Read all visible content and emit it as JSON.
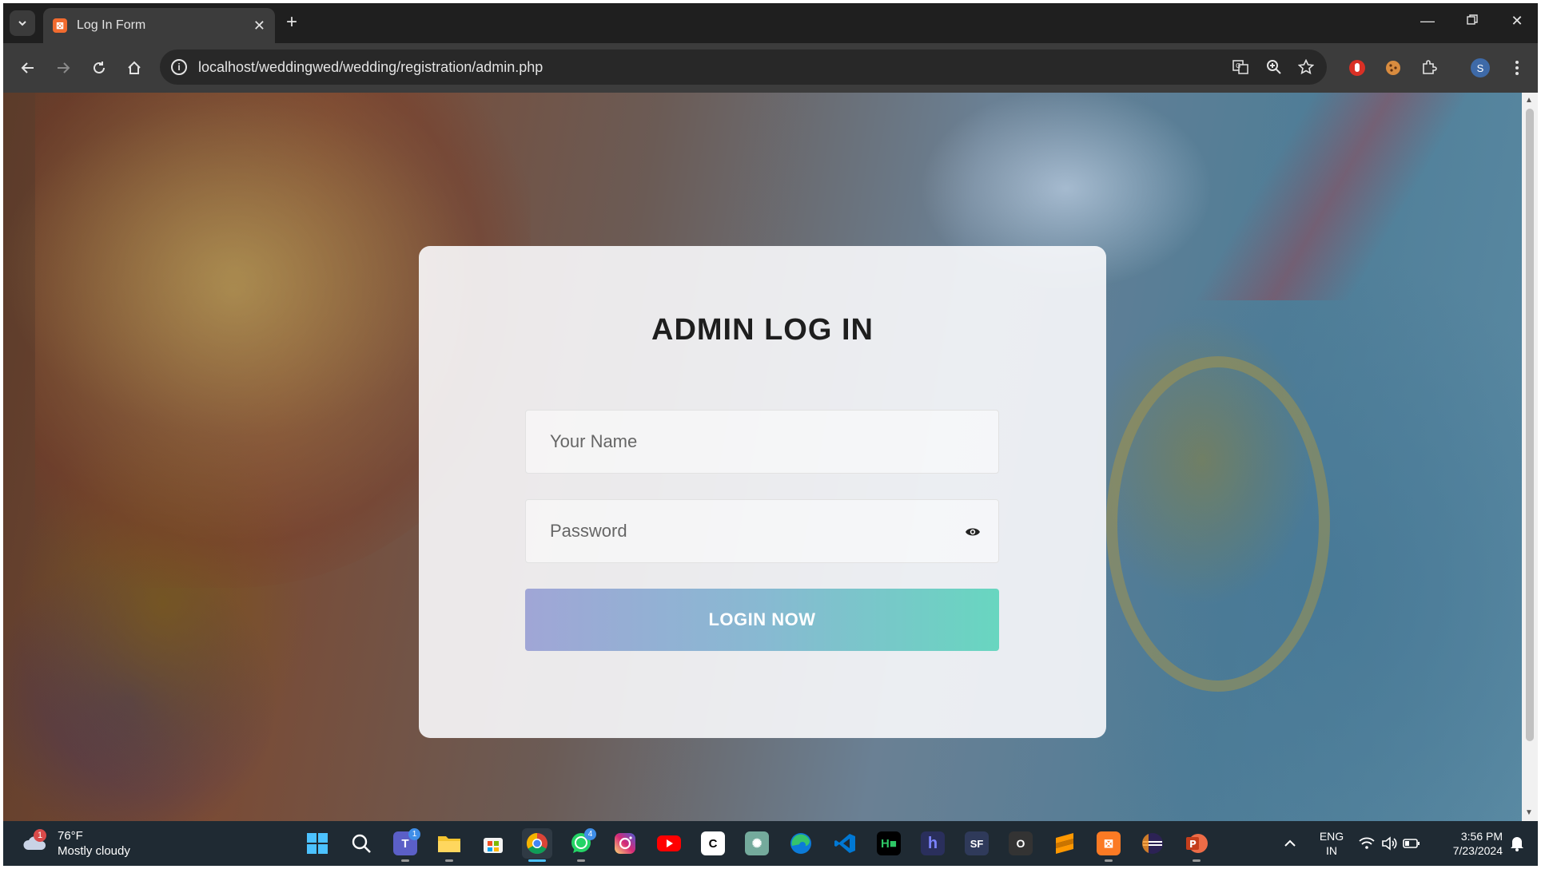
{
  "browser": {
    "tab_title": "Log In Form",
    "url": "localhost/weddingwed/wedding/registration/admin.php",
    "profile_initial": "S"
  },
  "page": {
    "title": "ADMIN LOG IN",
    "name_placeholder": "Your Name",
    "password_placeholder": "Password",
    "login_button": "LOGIN NOW"
  },
  "taskbar": {
    "weather_badge": "1",
    "weather_temp": "76°F",
    "weather_desc": "Mostly cloudy",
    "teams_badge": "1",
    "whatsapp_badge": "4",
    "lang_line1": "ENG",
    "lang_line2": "IN",
    "time": "3:56 PM",
    "date": "7/23/2024"
  },
  "colors": {
    "login_gradient_start": "#a0a6d6",
    "login_gradient_end": "#68d6c0",
    "browser_dark": "#1f1f1f",
    "taskbar": "#1f2a33"
  }
}
